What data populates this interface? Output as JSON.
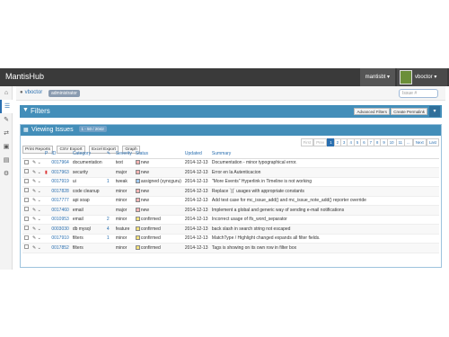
{
  "app": {
    "brand": "MantisHub"
  },
  "navbar": {
    "project": "mantisbt ▾",
    "user": "vboctor ▾"
  },
  "sidebar": {
    "icons": [
      "dashboard-icon",
      "list-icon",
      "edit-icon",
      "changelog-icon",
      "roadmap-icon",
      "summary-icon",
      "manage-icon"
    ]
  },
  "breadcrumb": {
    "user": "vboctor",
    "role": "administrator",
    "issue_placeholder": "Issue #"
  },
  "filters": {
    "title": "Filters",
    "advanced": "Advanced Filters",
    "permalink": "Create Permalink",
    "toggle": "▾"
  },
  "viewing": {
    "title": "Viewing Issues",
    "count": "1 - 50 / 2042"
  },
  "toolbar": {
    "print": "Print Reports",
    "csv": "CSV Export",
    "excel": "Excel Export",
    "graph": "Graph"
  },
  "pager": {
    "first": "First",
    "prev": "Prev",
    "pages": [
      "1",
      "2",
      "3",
      "4",
      "5",
      "6",
      "7",
      "8",
      "9",
      "10",
      "11",
      "..."
    ],
    "current": "1",
    "next": "Next",
    "last": "Last"
  },
  "columns": {
    "priority": "P",
    "id": "ID",
    "category": "Category",
    "notes": "✎",
    "severity": "Severity",
    "status": "Status",
    "updated": "Updated",
    "summary": "Summary"
  },
  "colors": {
    "new": "#f5b3b3",
    "assigned": "#9fc9f2",
    "confirmed": "#f5e27a",
    "accent": "#438eb9"
  },
  "rows": [
    {
      "prio": "",
      "id": "0017964",
      "category": "documentation",
      "notes": "",
      "severity": "text",
      "status": "new",
      "status_color": "#f5b3b3",
      "updated": "2014-12-13",
      "summary": "Documentation - minor typographical error."
    },
    {
      "prio": "▮",
      "id": "0017963",
      "category": "security",
      "notes": "",
      "severity": "major",
      "status": "new",
      "status_color": "#f5b3b3",
      "updated": "2014-12-13",
      "summary": "Error en la Autenticacion"
    },
    {
      "prio": "",
      "id": "0017919",
      "category": "ui",
      "notes": "1",
      "severity": "tweak",
      "status": "assigned (syncguru)",
      "status_color": "#9fc9f2",
      "updated": "2014-12-13",
      "summary": "\"More Events\" Hyperlink in Timeline is not working"
    },
    {
      "prio": "",
      "id": "0017828",
      "category": "code cleanup",
      "notes": "",
      "severity": "minor",
      "status": "new",
      "status_color": "#f5b3b3",
      "updated": "2014-12-13",
      "summary": "Replace `||` usages with appropriate constants"
    },
    {
      "prio": "",
      "id": "0017777",
      "category": "api soap",
      "notes": "",
      "severity": "minor",
      "status": "new",
      "status_color": "#f5b3b3",
      "updated": "2014-12-13",
      "summary": "Add test case for mc_issue_add() and mc_issue_note_add() reporter override"
    },
    {
      "prio": "",
      "id": "0017460",
      "category": "email",
      "notes": "",
      "severity": "major",
      "status": "new",
      "status_color": "#f5b3b3",
      "updated": "2014-12-13",
      "summary": "Implement a global and generic way of sending e-mail notifications"
    },
    {
      "prio": "",
      "id": "0010953",
      "category": "email",
      "notes": "2",
      "severity": "minor",
      "status": "confirmed",
      "status_color": "#f5e27a",
      "updated": "2014-12-13",
      "summary": "Incorrect usage of lfs_word_separator"
    },
    {
      "prio": "",
      "id": "0003030",
      "category": "db mysql",
      "notes": "4",
      "severity": "feature",
      "status": "confirmed",
      "status_color": "#f5e27a",
      "updated": "2014-12-13",
      "summary": "back slash in search string not escaped"
    },
    {
      "prio": "",
      "id": "0017910",
      "category": "filters",
      "notes": "1",
      "severity": "minor",
      "status": "confirmed",
      "status_color": "#f5e27a",
      "updated": "2014-12-13",
      "summary": "MatchType / Highlight changed expands all filter fields."
    },
    {
      "prio": "",
      "id": "0017852",
      "category": "filters",
      "notes": "",
      "severity": "minor",
      "status": "confirmed",
      "status_color": "#f5e27a",
      "updated": "2014-12-13",
      "summary": "Tags is showing on its own row in filter box"
    }
  ]
}
